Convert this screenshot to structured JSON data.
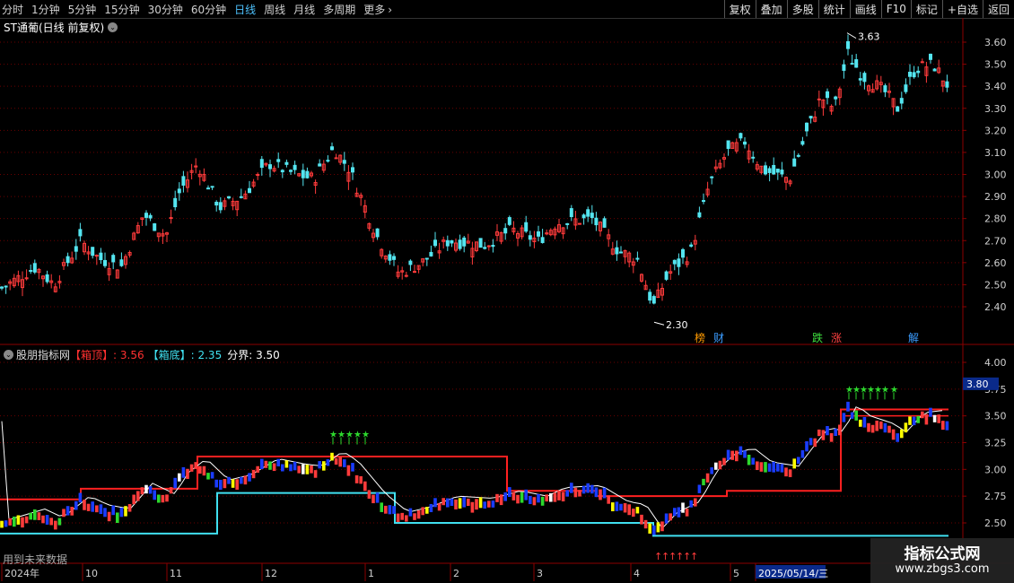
{
  "toolbar": {
    "periods": [
      "分时",
      "1分钟",
      "5分钟",
      "15分钟",
      "30分钟",
      "60分钟",
      "日线",
      "周线",
      "月线",
      "多周期",
      "更多"
    ],
    "active_period": "日线",
    "right_buttons": [
      "复权",
      "叠加",
      "多股",
      "统计",
      "画线",
      "F10",
      "标记",
      "+自选",
      "返回"
    ]
  },
  "main": {
    "title": "ST通葡(日线 前复权)",
    "high_label": "3.63",
    "low_label": "2.30",
    "y_ticks": [
      "3.60",
      "3.50",
      "3.40",
      "3.30",
      "3.20",
      "3.10",
      "3.00",
      "2.90",
      "2.80",
      "2.70",
      "2.60",
      "2.50",
      "2.40"
    ],
    "events": [
      {
        "text": "榜",
        "color": "#ff9a00"
      },
      {
        "text": "财",
        "color": "#3b9cff"
      },
      {
        "text": "跌",
        "color": "#3ee03e"
      },
      {
        "text": "涨",
        "color": "#ff4040"
      },
      {
        "text": "解",
        "color": "#3b9cff"
      }
    ]
  },
  "indicator": {
    "name": "股朋指标网",
    "top_label": "【箱顶】",
    "top_value": ": 3.56",
    "bottom_label": "【箱底】",
    "bottom_value": ": 2.35",
    "divider_label": "分界",
    "divider_value": ": 3.50",
    "y_ticks": [
      "4.00",
      "3.75",
      "3.50",
      "3.25",
      "3.00",
      "2.75",
      "2.50"
    ],
    "current_value": "3.80"
  },
  "x_axis": {
    "labels": [
      "2024年",
      "10",
      "11",
      "12",
      "1",
      "2",
      "3",
      "4",
      "5",
      "2025/05/14/三"
    ]
  },
  "note": "用到未来数据",
  "watermark": {
    "line1": "指标公式网",
    "line2": "www.zbgs3.com"
  },
  "colors": {
    "up": "#ff3b3b",
    "down": "#54e5f0",
    "box_top": "#ff2020",
    "box_bottom": "#40e0f0",
    "blue": "#1a3cff",
    "green": "#2dd82d",
    "yellow": "#ffff00",
    "white": "#ffffff"
  }
}
